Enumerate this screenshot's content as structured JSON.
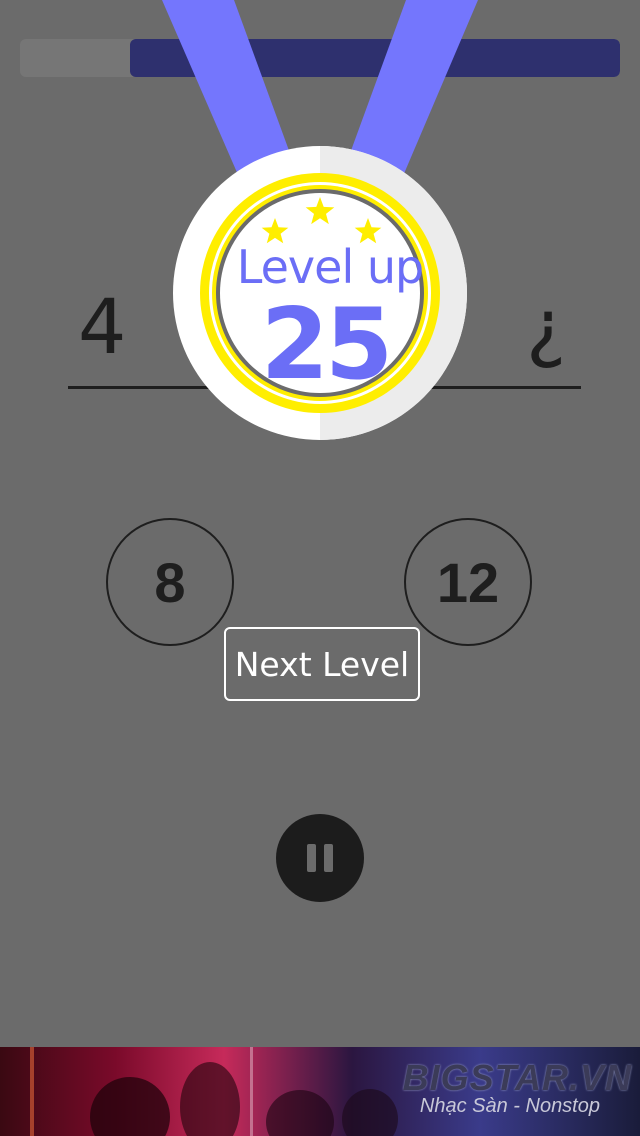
{
  "progress": {
    "fraction": 0.817
  },
  "equation": {
    "left_value": "4",
    "right_value": "¿"
  },
  "choices": [
    {
      "label": "8"
    },
    {
      "label": "12"
    }
  ],
  "next_button": {
    "label": "Next Level"
  },
  "medal": {
    "title": "Level up",
    "level": "25",
    "stars": 3
  },
  "ad_banner": {
    "brand": "BIGSTAR.VN",
    "tagline": "Nhạc Sàn - Nonstop"
  },
  "colors": {
    "background": "#6b6b6b",
    "progress_fill": "#2e306e",
    "ribbon": "#7476fd",
    "medal_ring": "#ffee00",
    "medal_text": "#6b6ef6",
    "star": "#ffee00"
  }
}
